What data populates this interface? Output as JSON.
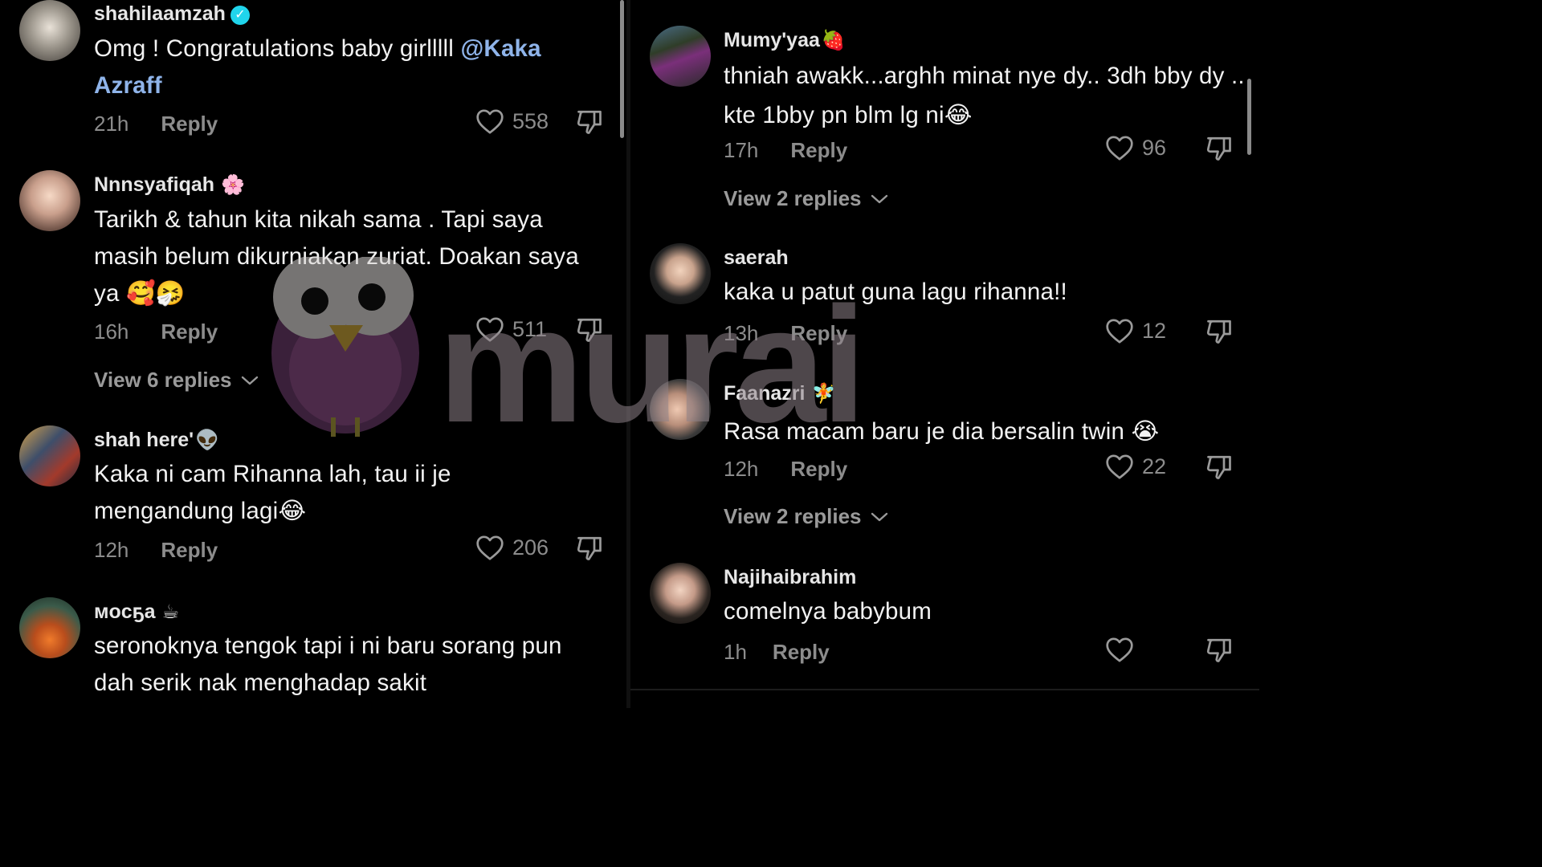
{
  "left": {
    "comments": [
      {
        "username": "shahilaamzah",
        "verified": true,
        "text_prefix": "Omg ! Congratulations baby girlllll ",
        "mention": "@Kaka Azraff",
        "time": "21h",
        "reply_label": "Reply",
        "likes": "558"
      },
      {
        "username": "Nnnsyafiqah",
        "tag": "🌸",
        "text": "Tarikh & tahun kita nikah sama . Tapi saya masih belum dikurniakan zuriat. Doakan saya ya 🥰🤧",
        "time": "16h",
        "reply_label": "Reply",
        "likes": "511",
        "view_replies": "View 6 replies"
      },
      {
        "username": "shah here'",
        "tag": "👽",
        "text": "Kaka ni cam Rihanna lah, tau ii je mengandung lagi😂",
        "time": "12h",
        "reply_label": "Reply",
        "likes": "206"
      },
      {
        "username": "мocҕa",
        "tag": "☕",
        "text": "seronoknya tengok tapi i ni baru sorang pun dah serik nak menghadap sakit"
      }
    ]
  },
  "right": {
    "comments": [
      {
        "username": "Mumy'yaa",
        "tag": "🍓",
        "text": "thniah awakk...arghh minat nye dy.. 3dh bby dy .. kte 1bby pn blm lg ni😂",
        "time": "17h",
        "reply_label": "Reply",
        "likes": "96",
        "view_replies": "View 2 replies"
      },
      {
        "username": "saerah",
        "text": "kaka u patut guna lagu rihanna!!",
        "time": "13h",
        "reply_label": "Reply",
        "likes": "12"
      },
      {
        "username": "Faanazri",
        "tag": "🧚",
        "text": "Rasa macam baru je dia bersalin twin 😭",
        "time": "12h",
        "reply_label": "Reply",
        "likes": "22",
        "view_replies": "View 2 replies"
      },
      {
        "username": "Najihaibrahim",
        "text": "comelnya babybum",
        "time": "1h",
        "reply_label": "Reply",
        "likes": ""
      }
    ]
  },
  "watermark": {
    "text": "murai"
  },
  "icons": {
    "like": "heart-outline-icon",
    "dislike": "thumbs-down-icon",
    "expand": "chevron-down-icon",
    "verified": "verified-badge-icon"
  },
  "colors": {
    "background": "#000000",
    "mention": "#8fb4ea",
    "verified": "#20d5ec",
    "muted": "#8c8c8c"
  }
}
